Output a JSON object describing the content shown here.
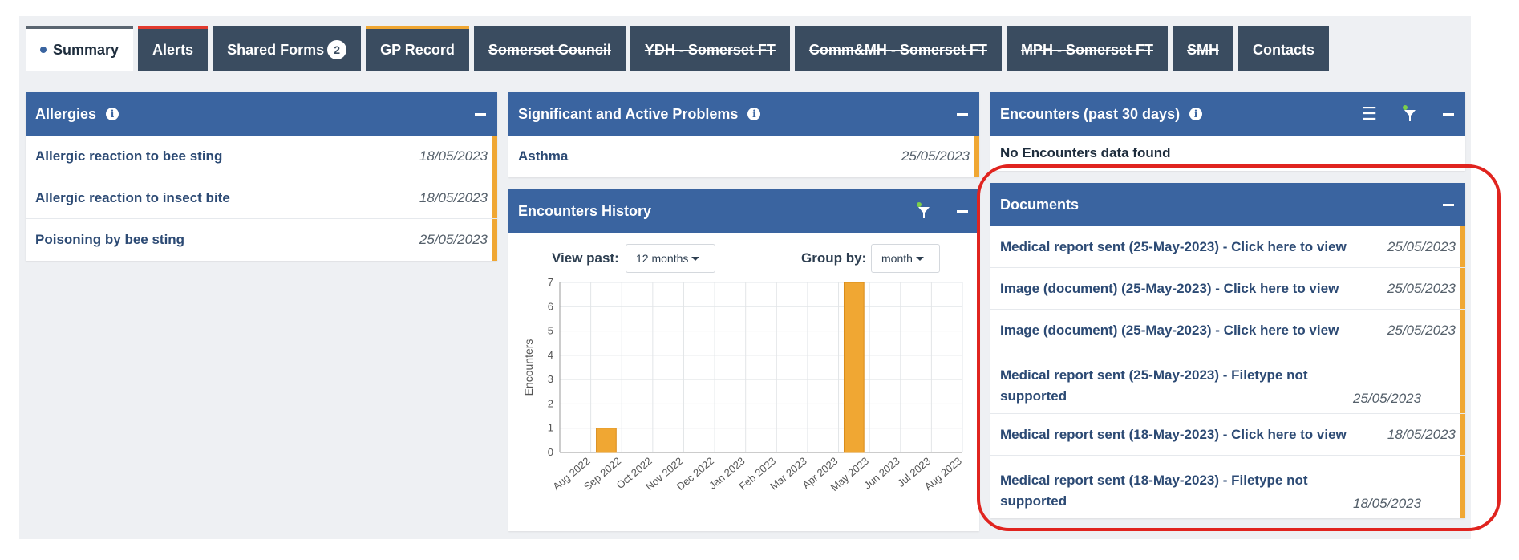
{
  "tabs": [
    {
      "label": "Summary",
      "style": "active"
    },
    {
      "label": "Alerts",
      "style": "red"
    },
    {
      "label": "Shared Forms",
      "badge": "2"
    },
    {
      "label": "GP Record",
      "style": "amber"
    },
    {
      "label": "Somerset Council",
      "strike": true
    },
    {
      "label": "YDH - Somerset FT",
      "strike": true
    },
    {
      "label": "Comm&MH - Somerset FT",
      "strike": true
    },
    {
      "label": "MPH - Somerset FT",
      "strike": true
    },
    {
      "label": "SMH",
      "strike": true
    },
    {
      "label": "Contacts"
    }
  ],
  "allergies": {
    "title": "Allergies",
    "rows": [
      {
        "text": "Allergic reaction to bee sting",
        "date": "18/05/2023"
      },
      {
        "text": "Allergic reaction to insect bite",
        "date": "18/05/2023"
      },
      {
        "text": "Poisoning by bee sting",
        "date": "25/05/2023"
      }
    ]
  },
  "problems": {
    "title": "Significant and Active Problems",
    "rows": [
      {
        "text": "Asthma",
        "date": "25/05/2023"
      }
    ]
  },
  "encounters_recent": {
    "title": "Encounters (past 30 days)",
    "empty_text": "No Encounters data found"
  },
  "encounters_history": {
    "title": "Encounters History",
    "view_past_label": "View past:",
    "view_past_value": "12 months",
    "group_by_label": "Group by:",
    "group_by_value": "month"
  },
  "chart_data": {
    "type": "bar",
    "categories": [
      "Aug 2022",
      "Sep 2022",
      "Oct 2022",
      "Nov 2022",
      "Dec 2022",
      "Jan 2023",
      "Feb 2023",
      "Mar 2023",
      "Apr 2023",
      "May 2023",
      "Jun 2023",
      "Jul 2023",
      "Aug 2023"
    ],
    "values": [
      0,
      1,
      0,
      0,
      0,
      0,
      0,
      0,
      0,
      7,
      0,
      0,
      0
    ],
    "title": "",
    "xlabel": "",
    "ylabel": "Encounters",
    "ylim": [
      0,
      7
    ],
    "yticks": [
      0,
      1,
      2,
      3,
      4,
      5,
      6,
      7
    ],
    "grid": true,
    "bar_color": "#f0a733"
  },
  "documents": {
    "title": "Documents",
    "rows": [
      {
        "text": "Medical report sent (25-May-2023) - Click here to view",
        "date": "25/05/2023"
      },
      {
        "text": "Image (document) (25-May-2023) - Click here to view",
        "date": "25/05/2023"
      },
      {
        "text": "Image (document) (25-May-2023) - Click here to view",
        "date": "25/05/2023"
      },
      {
        "text": "Medical report sent (25-May-2023) - Filetype not supported",
        "date": "25/05/2023"
      },
      {
        "text": "Medical report sent (18-May-2023) - Click here to view",
        "date": "18/05/2023"
      },
      {
        "text": "Medical report sent (18-May-2023) - Filetype not supported",
        "date": "18/05/2023"
      }
    ]
  },
  "colors": {
    "header": "#3a64a0",
    "accent": "#f0a733",
    "tab": "#3a4c60",
    "highlight": "#e0241f"
  }
}
